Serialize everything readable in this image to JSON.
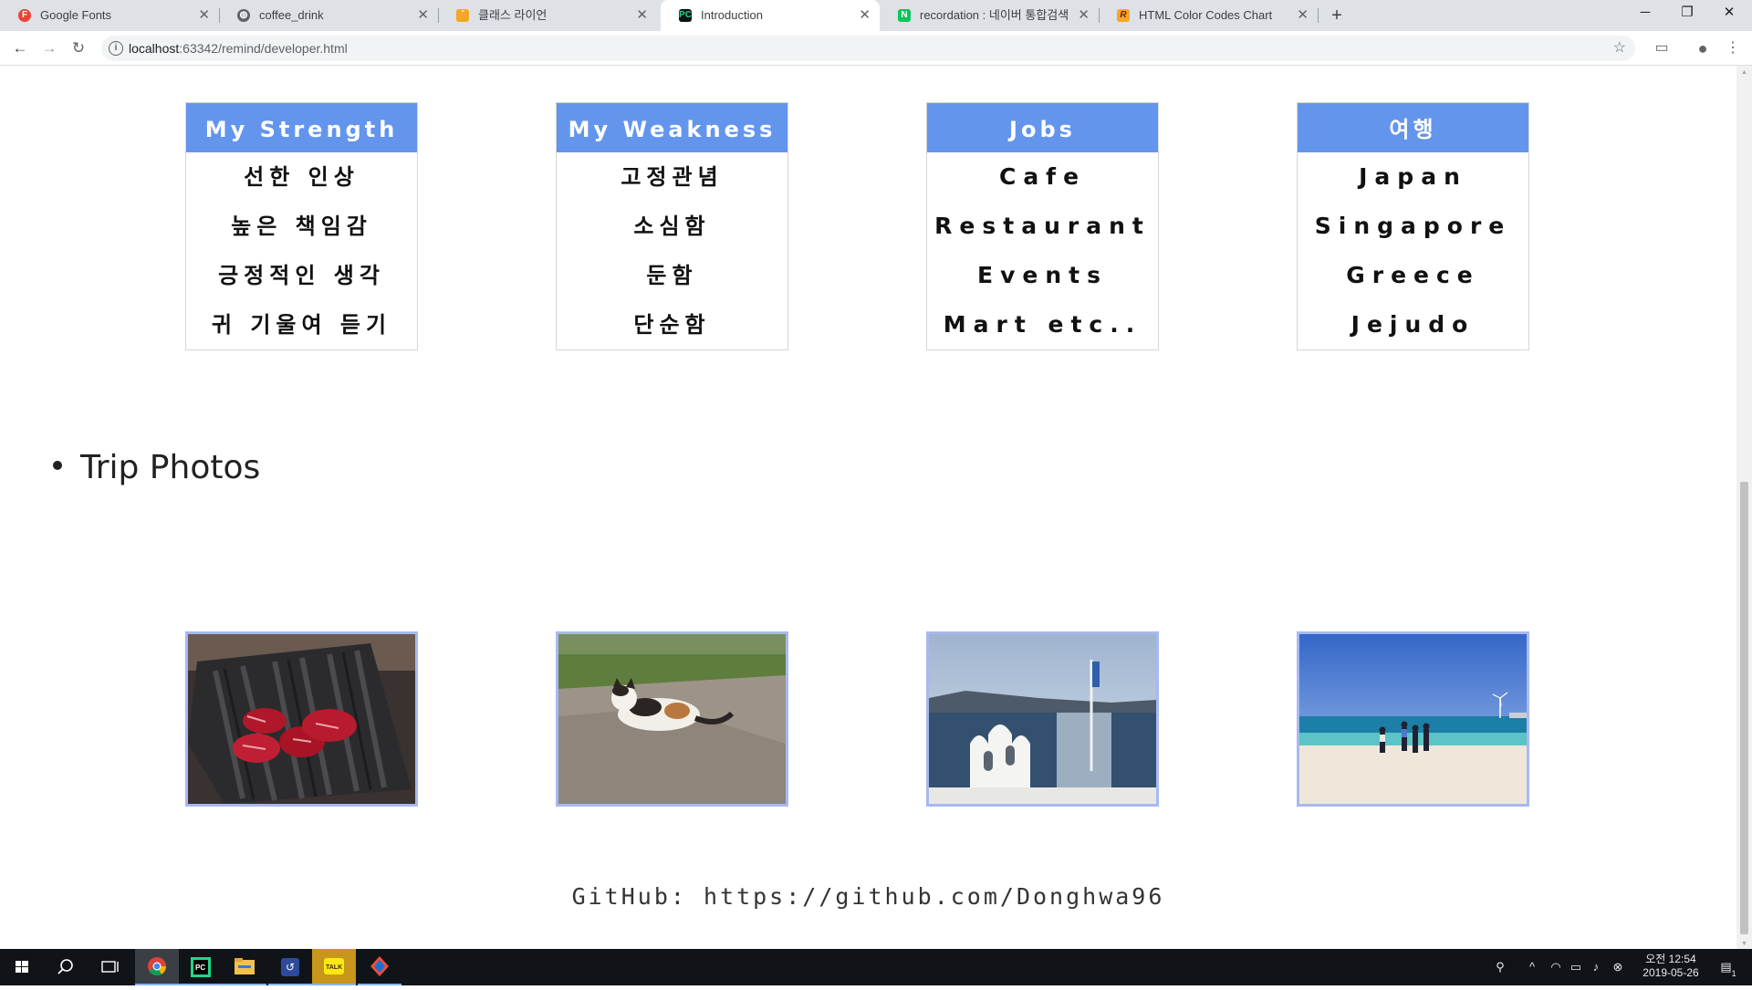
{
  "browser": {
    "tabs": [
      {
        "title": "Google Fonts",
        "favicon": "google-fonts-icon"
      },
      {
        "title": "coffee_drink",
        "favicon": "globe-icon"
      },
      {
        "title": "클래스 라이언",
        "favicon": "class-lion-icon"
      },
      {
        "title": "Introduction",
        "favicon": "pycharm-icon",
        "active": true
      },
      {
        "title": "recordation : 네이버 통합검색",
        "favicon": "naver-icon"
      },
      {
        "title": "HTML Color Codes Chart",
        "favicon": "rapidtables-icon"
      }
    ],
    "url_host": "localhost",
    "url_rest": ":63342/remind/developer.html"
  },
  "page": {
    "cards": [
      {
        "title": "My Strength",
        "items": [
          "선한 인상",
          "높은 책임감",
          "긍정적인 생각",
          "귀 기울여 듣기"
        ],
        "lang": "ko"
      },
      {
        "title": "My Weakness",
        "items": [
          "고정관념",
          "소심함",
          "둔함",
          "단순함"
        ],
        "lang": "ko"
      },
      {
        "title": "Jobs",
        "items": [
          "Cafe",
          "Restaurant",
          "Events",
          "Mart etc.."
        ],
        "lang": "en"
      },
      {
        "title": "여행",
        "items": [
          "Japan",
          "Singapore",
          "Greece",
          "Jejudo"
        ],
        "lang": "en"
      }
    ],
    "section_heading": "Trip Photos",
    "photos": [
      "beef-photo",
      "cat-photo",
      "greece-church-photo",
      "beach-photo"
    ],
    "footer": "GitHub: https://github.com/Donghwa96"
  },
  "taskbar": {
    "time": "오전 12:54",
    "date": "2019-05-26",
    "notification_count": "1"
  },
  "colors": {
    "card_header": "#6495ed",
    "photo_border": "#a7b9f2"
  }
}
